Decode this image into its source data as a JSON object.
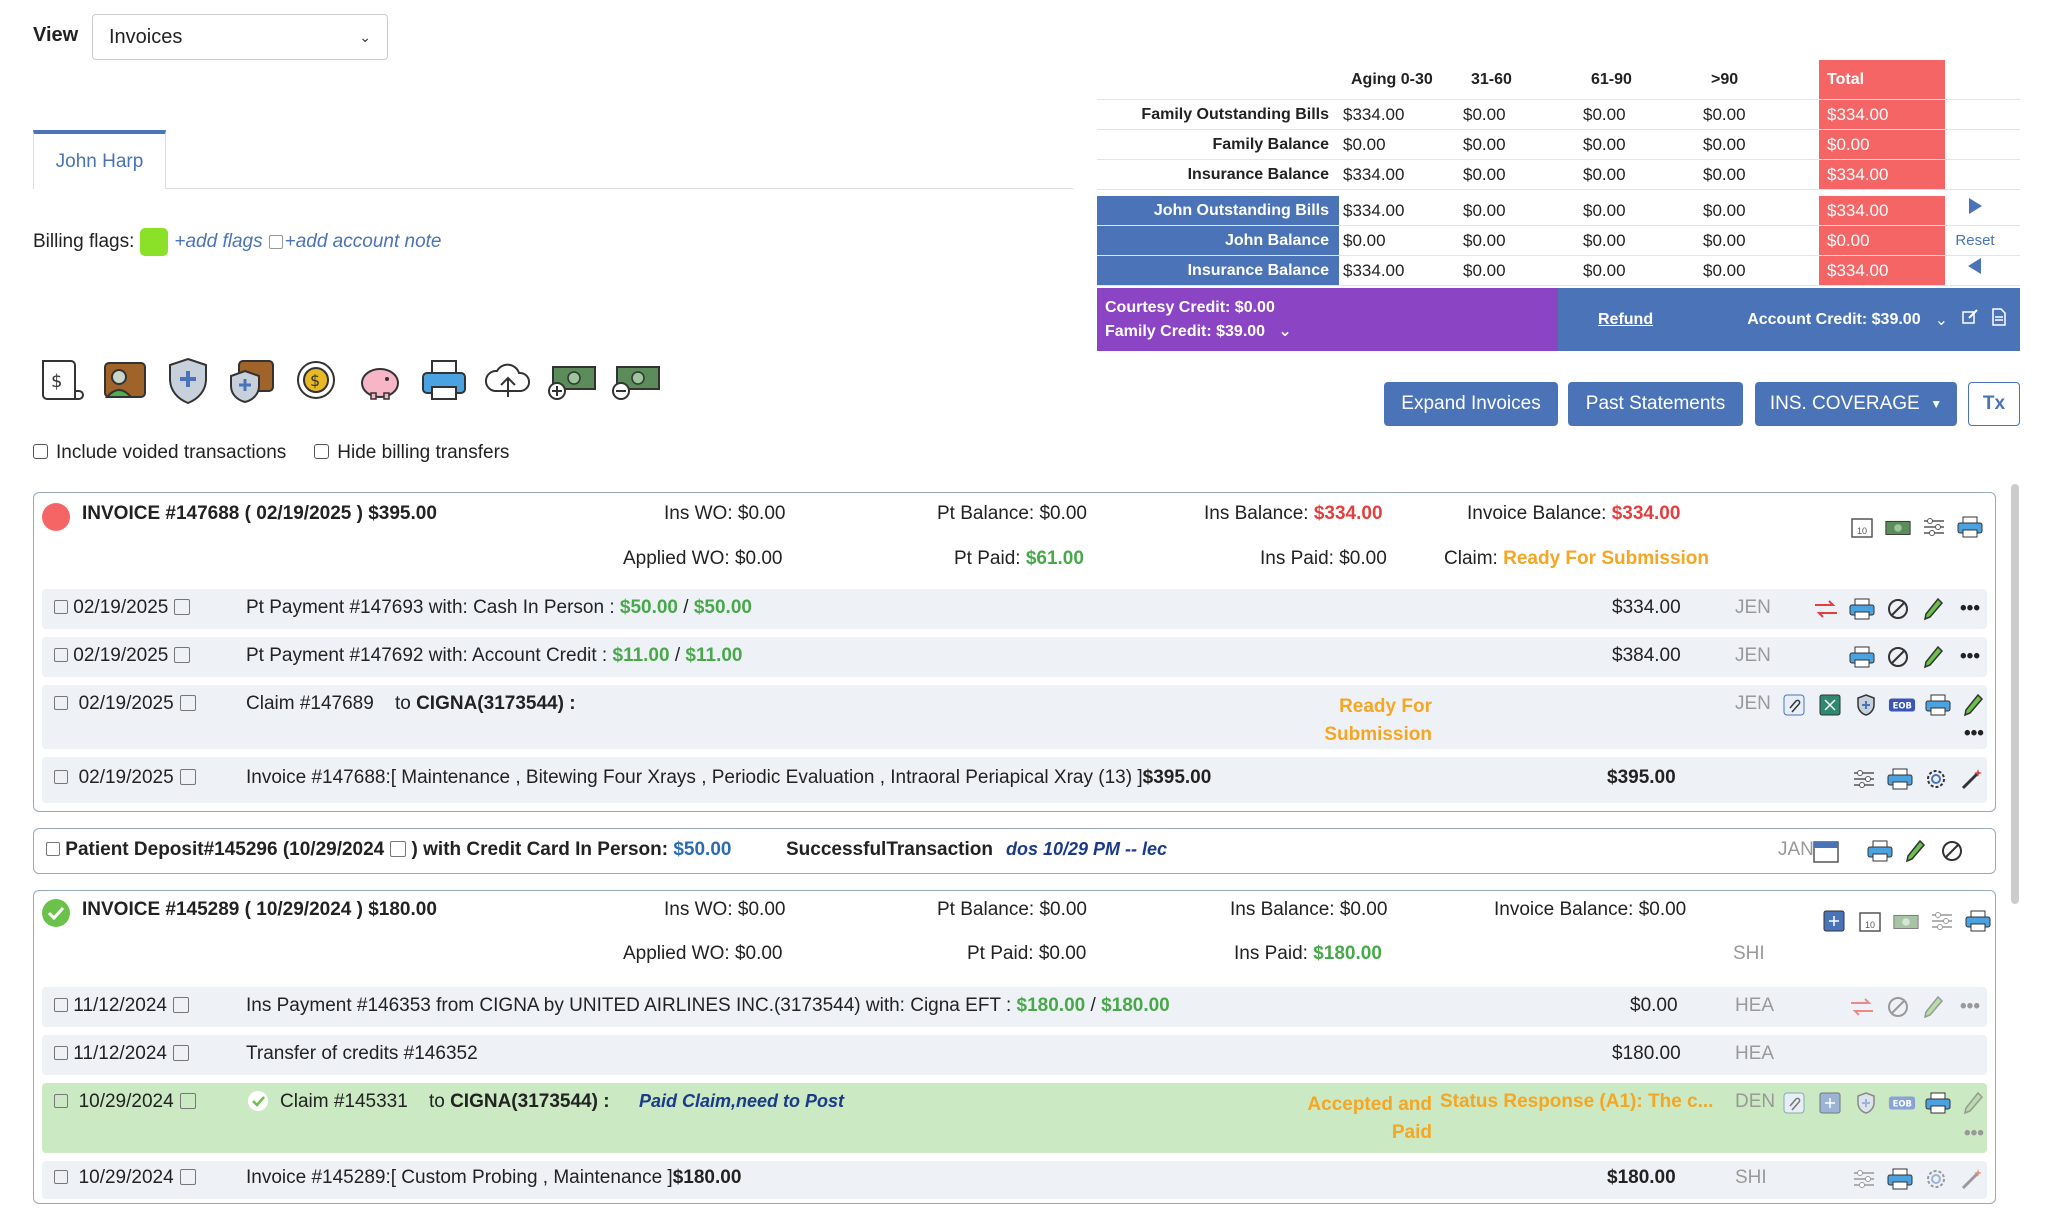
{
  "view": {
    "label": "View",
    "selected": "Invoices"
  },
  "tab": {
    "patient": "John Harp"
  },
  "billing": {
    "flags_label": "Billing flags:",
    "add_flags": "+add flags",
    "add_note": "+add account note"
  },
  "filters": {
    "include_voided": "Include voided transactions",
    "hide_transfers": "Hide billing transfers"
  },
  "aging": {
    "headers": [
      "Aging 0-30",
      "31-60",
      "61-90",
      ">90",
      "Total"
    ],
    "rows": [
      {
        "label": "Family Outstanding Bills",
        "values": [
          "$334.00",
          "$0.00",
          "$0.00",
          "$0.00",
          "$334.00"
        ]
      },
      {
        "label": "Family Balance",
        "values": [
          "$0.00",
          "$0.00",
          "$0.00",
          "$0.00",
          "$0.00"
        ]
      },
      {
        "label": "Insurance Balance",
        "values": [
          "$334.00",
          "$0.00",
          "$0.00",
          "$0.00",
          "$334.00"
        ]
      },
      {
        "label": "John Outstanding Bills",
        "values": [
          "$334.00",
          "$0.00",
          "$0.00",
          "$0.00",
          "$334.00"
        ]
      },
      {
        "label": "John Balance",
        "values": [
          "$0.00",
          "$0.00",
          "$0.00",
          "$0.00",
          "$0.00"
        ]
      },
      {
        "label": "Insurance Balance",
        "values": [
          "$334.00",
          "$0.00",
          "$0.00",
          "$0.00",
          "$334.00"
        ]
      }
    ],
    "reset": "Reset"
  },
  "credits": {
    "courtesy": "Courtesy Credit:  $0.00",
    "family": "Family Credit:  $39.00",
    "refund": "Refund",
    "account": "Account Credit: $39.00"
  },
  "buttons": {
    "expand": "Expand Invoices",
    "past": "Past Statements",
    "ins": "INS. COVERAGE",
    "tx": "Tx"
  },
  "inv1": {
    "title": "INVOICE #147688 ( 02/19/2025 ) $395.00",
    "ins_wo_l": "Ins WO:",
    "ins_wo": "$0.00",
    "pt_bal_l": "Pt Balance:",
    "pt_bal": "$0.00",
    "ins_bal_l": "Ins Balance:",
    "ins_bal": "$334.00",
    "inv_bal_l": "Invoice Balance:",
    "inv_bal": "$334.00",
    "app_wo_l": "Applied WO:",
    "app_wo": "$0.00",
    "pt_paid_l": "Pt Paid:",
    "pt_paid": "$61.00",
    "ins_paid_l": "Ins Paid:",
    "ins_paid": "$0.00",
    "claim_l": "Claim:",
    "claim": "Ready For Submission",
    "rows": [
      {
        "date": "02/19/2025",
        "desc": "Pt Payment #147693 with: Cash In Person :",
        "a1": "$50.00",
        "a2": "$50.00",
        "amount": "$334.00",
        "user": "JEN"
      },
      {
        "date": "02/19/2025",
        "desc": "Pt Payment #147692 with: Account Credit :",
        "a1": "$11.00",
        "a2": "$11.00",
        "amount": "$384.00",
        "user": "JEN"
      },
      {
        "date": "02/19/2025",
        "desc": "Claim #147689",
        "to": "to",
        "payer": "CIGNA(3173544) :",
        "status1": "Ready For",
        "status2": "Submission",
        "user": "JEN"
      },
      {
        "date": "02/19/2025",
        "desc": "Invoice #147688:[ Maintenance , Bitewing Four Xrays , Periodic Evaluation , Intraoral Periapical Xray (13) ]",
        "total": "$395.00",
        "amount": "$395.00"
      }
    ]
  },
  "deposit": {
    "label": "Patient Deposit#145296  (10/29/2024",
    "label2": ") with Credit Card In Person:",
    "amount": "$50.00",
    "status": "SuccessfulTransaction",
    "note": "dos 10/29 PM -- lec",
    "user": "JAN"
  },
  "inv2": {
    "title": "INVOICE #145289 ( 10/29/2024 ) $180.00",
    "ins_wo_l": "Ins WO:",
    "ins_wo": "$0.00",
    "pt_bal_l": "Pt Balance:",
    "pt_bal": "$0.00",
    "ins_bal_l": "Ins Balance:",
    "ins_bal": "$0.00",
    "inv_bal_l": "Invoice Balance:",
    "inv_bal": "$0.00",
    "app_wo_l": "Applied WO:",
    "app_wo": "$0.00",
    "pt_paid_l": "Pt Paid:",
    "pt_paid": "$0.00",
    "ins_paid_l": "Ins Paid:",
    "ins_paid": "$180.00",
    "user": "SHI",
    "rows": [
      {
        "date": "11/12/2024",
        "desc": "Ins Payment #146353 from CIGNA by UNITED AIRLINES INC.(3173544) with: Cigna EFT :",
        "a1": "$180.00",
        "a2": "$180.00",
        "amount": "$0.00",
        "user": "HEA"
      },
      {
        "date": "11/12/2024",
        "desc": "Transfer of credits #146352",
        "amount": "$180.00",
        "user": "HEA"
      },
      {
        "date": "10/29/2024",
        "desc": "Claim #145331",
        "to": "to",
        "payer": "CIGNA(3173544) :",
        "note": "Paid Claim,need to Post",
        "status1": "Accepted and",
        "status2": "Paid",
        "response": "Status Response (A1): The c...",
        "user": "DEN"
      },
      {
        "date": "10/29/2024",
        "desc": "Invoice #145289:[ Custom Probing , Maintenance ]",
        "total": "$180.00",
        "amount": "$180.00",
        "user": "SHI"
      }
    ]
  }
}
